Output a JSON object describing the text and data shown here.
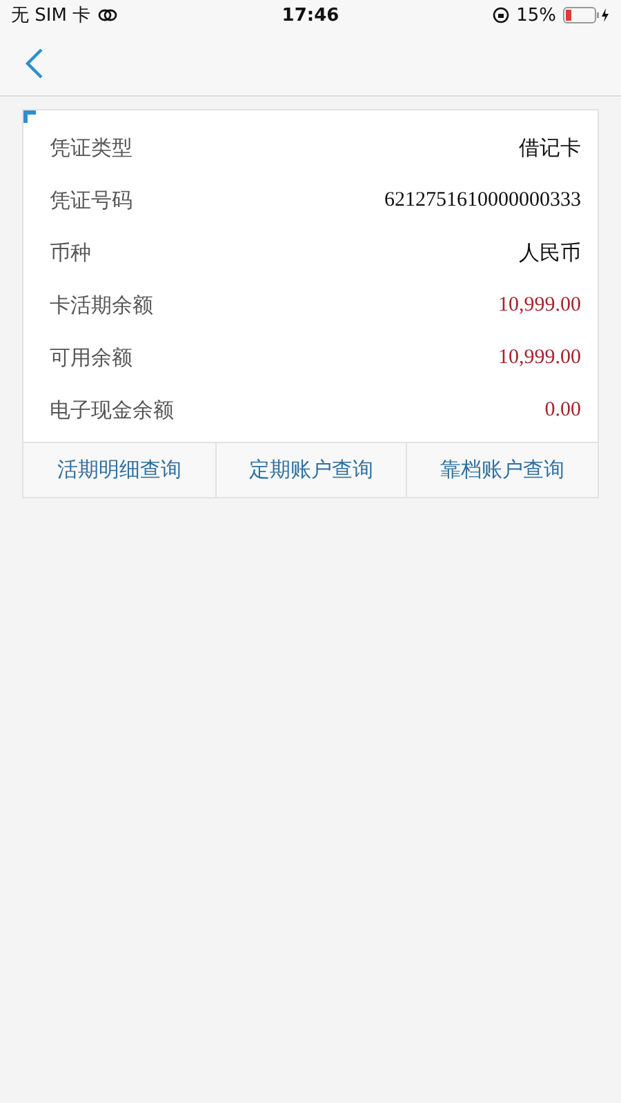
{
  "status_bar": {
    "carrier": "无 SIM 卡",
    "time": "17:46",
    "battery": "15%"
  },
  "details": [
    {
      "label": "凭证类型",
      "value": "借记卡",
      "kind": "text"
    },
    {
      "label": "凭证号码",
      "value": "6212751610000000333",
      "kind": "number"
    },
    {
      "label": "币种",
      "value": "人民币",
      "kind": "text"
    },
    {
      "label": "卡活期余额",
      "value": "10,999.00",
      "kind": "amount"
    },
    {
      "label": "可用余额",
      "value": "10,999.00",
      "kind": "amount"
    },
    {
      "label": "电子现金余额",
      "value": "0.00",
      "kind": "amount"
    }
  ],
  "actions": [
    "活期明细查询",
    "定期账户查询",
    "靠档账户查询"
  ]
}
